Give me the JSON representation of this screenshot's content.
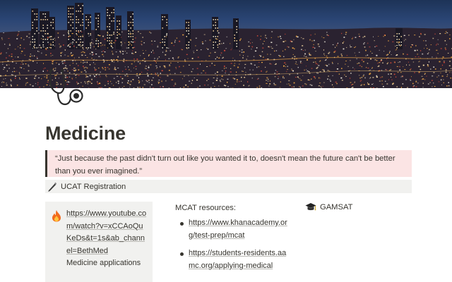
{
  "page": {
    "title": "Medicine",
    "icon": "stethoscope-icon",
    "cover": "city-skyline-night"
  },
  "quote": {
    "text": "“Just because the past didn't turn out like you wanted it to, doesn't mean the future can't be better than you ever imagined.”",
    "background": "#fbe4e4"
  },
  "toggle": {
    "icon": "pen-icon",
    "label": "UCAT Registration"
  },
  "callout": {
    "icon": "fire-icon",
    "url": "https://www.youtube.com/watch?v=xCCAoQuKeDs&t=1s&ab_channel=BethMed",
    "extra_text": "Medicine applications"
  },
  "mcat": {
    "heading": "MCAT resources:",
    "links": [
      "https://www.khanacademy.org/test-prep/mcat",
      "https://students-residents.aamc.org/applying-medical"
    ]
  },
  "gamsat": {
    "icon": "graduation-cap-icon",
    "label": "GAMSAT"
  }
}
